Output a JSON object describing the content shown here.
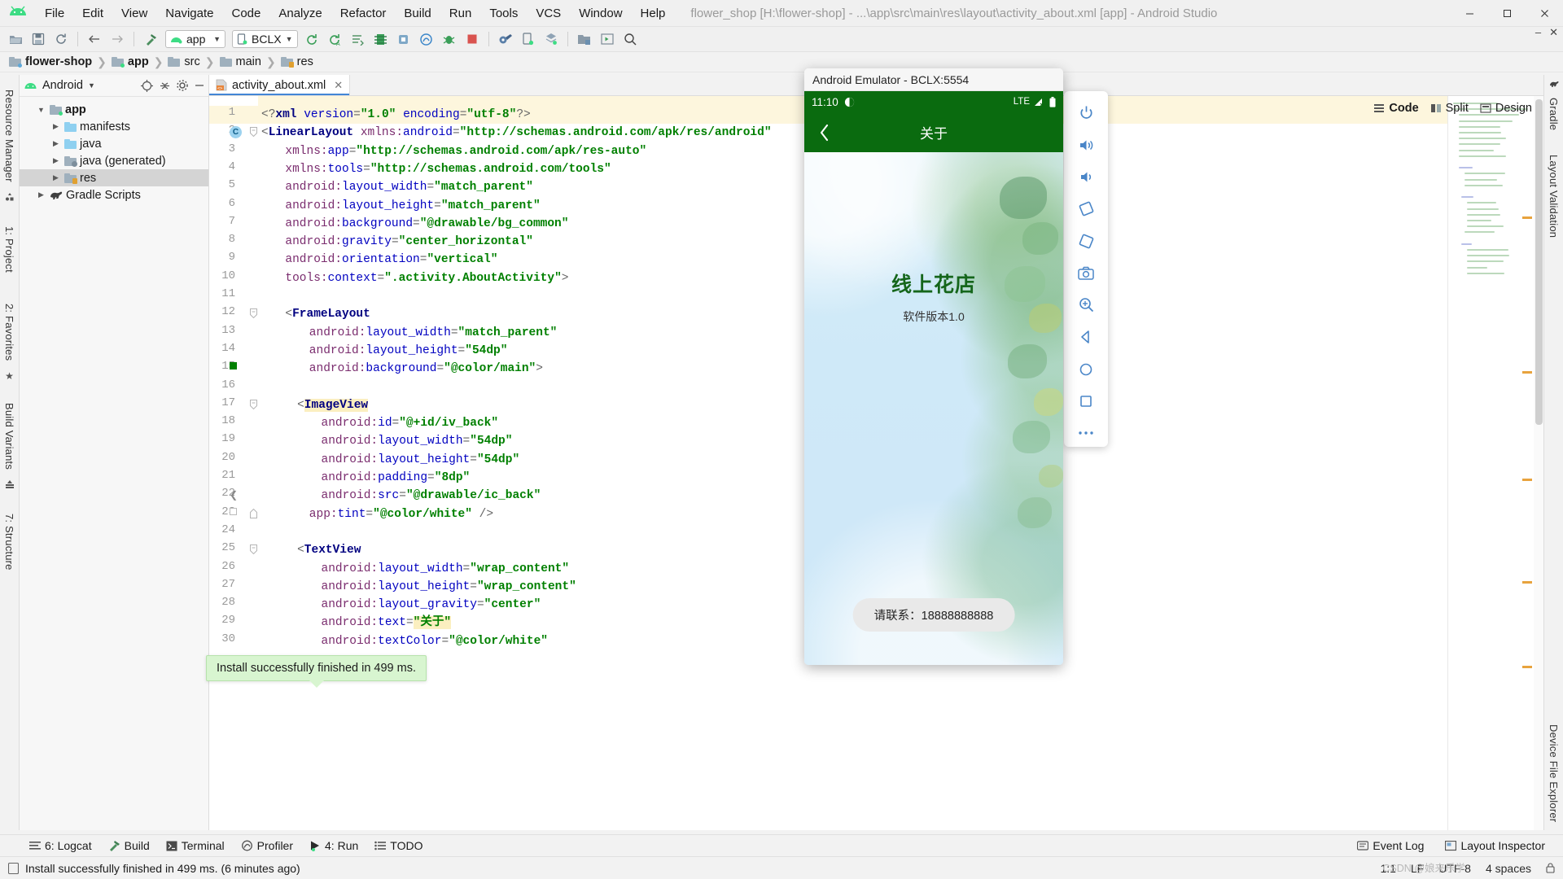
{
  "window": {
    "title": "flower_shop [H:\\flower-shop] - ...\\app\\src\\main\\res\\layout\\activity_about.xml [app] - Android Studio",
    "minimize": "–",
    "maximize": "▢",
    "close": "✕"
  },
  "menubar": {
    "items": [
      "File",
      "Edit",
      "View",
      "Navigate",
      "Code",
      "Analyze",
      "Refactor",
      "Build",
      "Run",
      "Tools",
      "VCS",
      "Window",
      "Help"
    ]
  },
  "toolbar": {
    "module_selector": "app",
    "device_selector": "BCLX"
  },
  "breadcrumb": {
    "items": [
      "flower-shop",
      "app",
      "src",
      "main",
      "res"
    ]
  },
  "project_panel": {
    "title": "Android",
    "tree": [
      {
        "label": "app",
        "bold": true,
        "depth": 0,
        "arrow": "▼",
        "icon": "module-folder",
        "selected": false
      },
      {
        "label": "manifests",
        "bold": false,
        "depth": 1,
        "arrow": "▶",
        "icon": "blue-folder",
        "selected": false
      },
      {
        "label": "java",
        "bold": false,
        "depth": 1,
        "arrow": "▶",
        "icon": "blue-folder",
        "selected": false
      },
      {
        "label": "java (generated)",
        "bold": false,
        "depth": 1,
        "arrow": "▶",
        "icon": "gen-folder",
        "selected": false
      },
      {
        "label": "res",
        "bold": false,
        "depth": 1,
        "arrow": "▶",
        "icon": "res-folder",
        "selected": true
      },
      {
        "label": "Gradle Scripts",
        "bold": false,
        "depth": 0,
        "arrow": "▶",
        "icon": "gradle-elephant",
        "selected": false
      }
    ]
  },
  "left_rail": {
    "items": [
      "Resource Manager",
      "1: Project",
      "2: Favorites",
      "Build Variants",
      "7: Structure"
    ]
  },
  "right_rail": {
    "items": [
      "Gradle",
      "Layout Validation",
      "Device File Explorer"
    ]
  },
  "editor": {
    "tab_name": "activity_about.xml",
    "tab_close": "✕",
    "modes": [
      {
        "label": "Code",
        "active": true
      },
      {
        "label": "Split",
        "active": false
      },
      {
        "label": "Design",
        "active": false
      }
    ],
    "lines": [
      {
        "n": 1,
        "highlight": true,
        "indent": 0,
        "text": "<?xml version=\"1.0\" encoding=\"utf-8\"?>"
      },
      {
        "n": 2,
        "highlight": false,
        "indent": 0,
        "text": "<LinearLayout xmlns:android=\"http://schemas.android.com/apk/res/android\""
      },
      {
        "n": 3,
        "highlight": false,
        "indent": 2,
        "text": "xmlns:app=\"http://schemas.android.com/apk/res-auto\""
      },
      {
        "n": 4,
        "highlight": false,
        "indent": 2,
        "text": "xmlns:tools=\"http://schemas.android.com/tools\""
      },
      {
        "n": 5,
        "highlight": false,
        "indent": 2,
        "text": "android:layout_width=\"match_parent\""
      },
      {
        "n": 6,
        "highlight": false,
        "indent": 2,
        "text": "android:layout_height=\"match_parent\""
      },
      {
        "n": 7,
        "highlight": false,
        "indent": 2,
        "text": "android:background=\"@drawable/bg_common\""
      },
      {
        "n": 8,
        "highlight": false,
        "indent": 2,
        "text": "android:gravity=\"center_horizontal\""
      },
      {
        "n": 9,
        "highlight": false,
        "indent": 2,
        "text": "android:orientation=\"vertical\""
      },
      {
        "n": 10,
        "highlight": false,
        "indent": 2,
        "text": "tools:context=\".activity.AboutActivity\">"
      },
      {
        "n": 11,
        "highlight": false,
        "indent": 0,
        "text": ""
      },
      {
        "n": 12,
        "highlight": false,
        "indent": 2,
        "text": "<FrameLayout"
      },
      {
        "n": 13,
        "highlight": false,
        "indent": 4,
        "text": "android:layout_width=\"match_parent\""
      },
      {
        "n": 14,
        "highlight": false,
        "indent": 4,
        "text": "android:layout_height=\"54dp\""
      },
      {
        "n": 15,
        "highlight": false,
        "indent": 4,
        "text": "android:background=\"@color/main\">"
      },
      {
        "n": 16,
        "highlight": false,
        "indent": 0,
        "text": ""
      },
      {
        "n": 17,
        "highlight": false,
        "indent": 3,
        "text": "<ImageView"
      },
      {
        "n": 18,
        "highlight": false,
        "indent": 5,
        "text": "android:id=\"@+id/iv_back\""
      },
      {
        "n": 19,
        "highlight": false,
        "indent": 5,
        "text": "android:layout_width=\"54dp\""
      },
      {
        "n": 20,
        "highlight": false,
        "indent": 5,
        "text": "android:layout_height=\"54dp\""
      },
      {
        "n": 21,
        "highlight": false,
        "indent": 5,
        "text": "android:padding=\"8dp\""
      },
      {
        "n": 22,
        "highlight": false,
        "indent": 5,
        "text": "android:src=\"@drawable/ic_back\""
      },
      {
        "n": 23,
        "highlight": false,
        "indent": 4,
        "text": "app:tint=\"@color/white\" />"
      },
      {
        "n": 24,
        "highlight": false,
        "indent": 0,
        "text": ""
      },
      {
        "n": 25,
        "highlight": false,
        "indent": 3,
        "text": "<TextView"
      },
      {
        "n": 26,
        "highlight": false,
        "indent": 5,
        "text": "android:layout_width=\"wrap_content\""
      },
      {
        "n": 27,
        "highlight": false,
        "indent": 5,
        "text": "android:layout_height=\"wrap_content\""
      },
      {
        "n": 28,
        "highlight": false,
        "indent": 5,
        "text": "android:layout_gravity=\"center\""
      },
      {
        "n": 29,
        "highlight": false,
        "indent": 5,
        "text": "android:text=\"关于\""
      },
      {
        "n": 30,
        "highlight": false,
        "indent": 5,
        "text": "android:textColor=\"@color/white\""
      }
    ],
    "highlighted_tokens": [
      "ImageView",
      "关于"
    ]
  },
  "emulator": {
    "window_title": "Android Emulator - BCLX:5554",
    "status_time": "11:10",
    "status_network": "LTE",
    "appbar_title": "关于",
    "back_icon": "chevron-left-icon",
    "app_name": "线上花店",
    "app_version": "软件版本1.0",
    "contact": "请联系：18888888888",
    "colors": {
      "appbar": "#0a6b0f",
      "background": "#cfe8f7",
      "app_name": "#15661b"
    },
    "side_tools": [
      "power-icon",
      "volume-up-icon",
      "volume-down-icon",
      "rotate-left-icon",
      "rotate-right-icon",
      "camera-icon",
      "zoom-icon",
      "back-nav-icon",
      "home-nav-icon",
      "overview-nav-icon",
      "more-icon"
    ],
    "minimize": "–",
    "close": "✕"
  },
  "notification": {
    "text": "Install successfully finished in 499 ms."
  },
  "tool_window_bar": {
    "items": [
      {
        "label": "6: Logcat",
        "icon": "logcat-icon"
      },
      {
        "label": "Build",
        "icon": "build-hammer-icon"
      },
      {
        "label": "Terminal",
        "icon": "terminal-icon"
      },
      {
        "label": "Profiler",
        "icon": "profiler-icon"
      },
      {
        "label": "4: Run",
        "icon": "run-play-icon"
      },
      {
        "label": "TODO",
        "icon": "todo-icon"
      }
    ],
    "right_items": [
      {
        "label": "Event Log",
        "icon": "event-log-icon"
      },
      {
        "label": "Layout Inspector",
        "icon": "layout-inspector-icon"
      }
    ]
  },
  "statusbar": {
    "message": "Install successfully finished in 499 ms. (6 minutes ago)",
    "caret": "1:1",
    "line_ending": "LF",
    "encoding": "UTF-8",
    "indent": "4 spaces",
    "watermark": "CSDN @娘来乐学"
  }
}
